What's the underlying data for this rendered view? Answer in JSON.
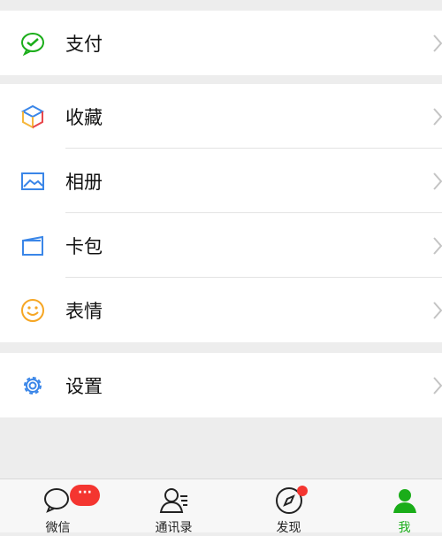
{
  "menu": {
    "pay": {
      "label": "支付",
      "icon": "wechat-pay-icon"
    },
    "favorites": {
      "label": "收藏",
      "icon": "cube-icon"
    },
    "album": {
      "label": "相册",
      "icon": "image-icon"
    },
    "cards": {
      "label": "卡包",
      "icon": "wallet-card-icon"
    },
    "stickers": {
      "label": "表情",
      "icon": "smiley-icon"
    },
    "settings": {
      "label": "设置",
      "icon": "gear-icon"
    }
  },
  "tabbar": {
    "chats": {
      "label": "微信",
      "badge": "···",
      "icon": "chat-bubble-icon"
    },
    "contacts": {
      "label": "通讯录",
      "icon": "contacts-icon"
    },
    "discover": {
      "label": "发现",
      "icon": "compass-icon"
    },
    "me": {
      "label": "我",
      "icon": "person-icon"
    }
  },
  "colors": {
    "accent": "#1aad19",
    "badge": "#f43530",
    "background": "#ededed"
  }
}
